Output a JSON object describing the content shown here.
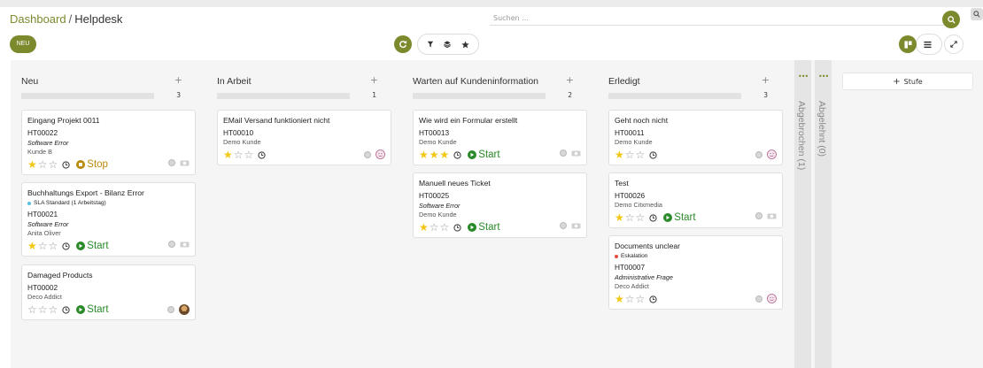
{
  "breadcrumb": {
    "parent": "Dashboard",
    "separator": "/",
    "current": "Helpdesk"
  },
  "search": {
    "placeholder": "Suchen ..."
  },
  "toolbar": {
    "new_label": "NEU"
  },
  "add_stage": {
    "label": "Stufe"
  },
  "columns": [
    {
      "title": "Neu",
      "count": "3",
      "add": "+"
    },
    {
      "title": "In Arbeit",
      "count": "1",
      "add": "+"
    },
    {
      "title": "Warten auf Kundeninformation",
      "count": "2",
      "add": "+"
    },
    {
      "title": "Erledigt",
      "count": "3",
      "add": "+"
    }
  ],
  "folded": [
    {
      "label": "Abgebrochen (1)"
    },
    {
      "label": "Abgelehnt (0)"
    }
  ],
  "cards": {
    "c1": {
      "title": "Eingang Projekt 0011",
      "ref": "HT00022",
      "type": "Software Error",
      "customer": "Kunde B",
      "action": "Stop",
      "stars": 1
    },
    "c2": {
      "title": "Buchhaltungs Export - Bilanz Error",
      "tag": "SLA Standard (1 Arbeitstag)",
      "ref": "HT00021",
      "type": "Software Error",
      "customer": "Anita Oliver",
      "action": "Start",
      "stars": 1
    },
    "c3": {
      "title": "Damaged Products",
      "ref": "HT00002",
      "customer": "Deco Addict",
      "action": "Start",
      "stars": 0
    },
    "c4": {
      "title": "EMail Versand funktioniert nicht",
      "ref": "HT00010",
      "customer": "Demo Kunde",
      "stars": 1
    },
    "c5": {
      "title": "Wie wird ein Formular erstellt",
      "ref": "HT00013",
      "customer": "Demo Kunde",
      "action": "Start",
      "stars": 3
    },
    "c6": {
      "title": "Manuell neues Ticket",
      "ref": "HT00025",
      "type": "Software Error",
      "customer": "Demo Kunde",
      "action": "Start",
      "stars": 1
    },
    "c7": {
      "title": "Geht noch nicht",
      "ref": "HT00011",
      "customer": "Demo Kunde",
      "stars": 1
    },
    "c8": {
      "title": "Test",
      "ref": "HT00026",
      "customer": "Demo Citxmedia",
      "action": "Start",
      "stars": 1
    },
    "c9": {
      "title": "Documents unclear",
      "tag": "Eskalation",
      "ref": "HT00007",
      "type": "Administrative Frage",
      "customer": "Deco Addict",
      "stars": 1
    }
  },
  "colors": {
    "accent": "#7c8a2d",
    "star": "#f3c614",
    "start": "#2a8a2a",
    "stop": "#b78a09",
    "sla_tag": "#5bc0de",
    "escalation_tag": "#e74c3c"
  }
}
